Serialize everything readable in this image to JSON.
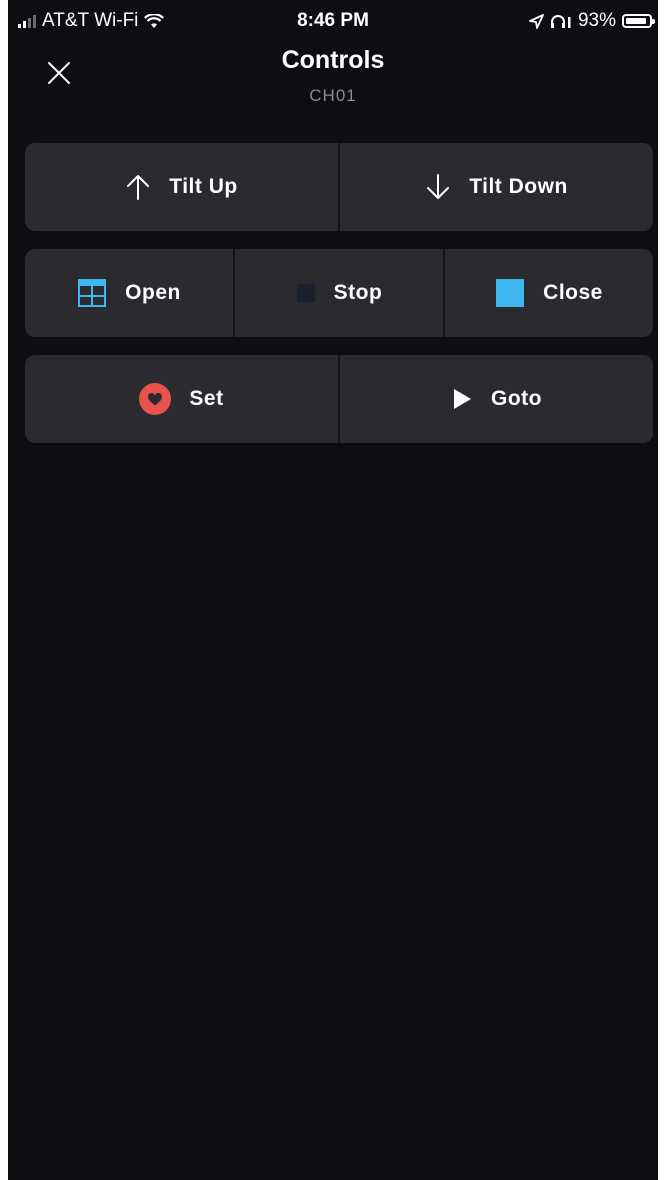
{
  "status_bar": {
    "carrier": "AT&T Wi-Fi",
    "time": "8:46 PM",
    "battery_text": "93%",
    "battery_level": 0.93
  },
  "header": {
    "title": "Controls",
    "subtitle": "CH01"
  },
  "controls": {
    "tilt_up_label": "Tilt Up",
    "tilt_down_label": "Tilt Down",
    "open_label": "Open",
    "stop_label": "Stop",
    "close_label": "Close",
    "set_label": "Set",
    "goto_label": "Goto"
  },
  "icons": {
    "close": "close-icon",
    "tilt_up": "arrow-up-icon",
    "tilt_down": "arrow-down-icon",
    "open": "window-open-icon",
    "stop": "stop-square-icon",
    "close_shade": "shade-closed-icon",
    "set": "heart-icon",
    "goto": "play-icon"
  },
  "colors": {
    "background": "#0e0e12",
    "button": "#2b2b2f",
    "accent_blue": "#3fb8ef",
    "stop_square": "#1c1f2e",
    "heart_red": "#e8534e",
    "subtitle": "#8a8a90"
  }
}
